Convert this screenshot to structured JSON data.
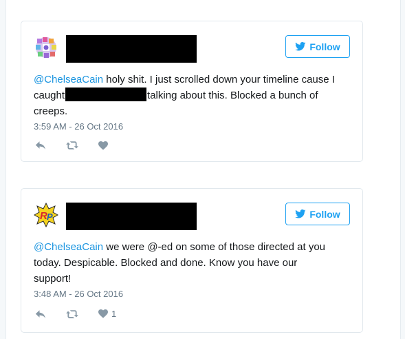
{
  "tweets": [
    {
      "follow_label": "Follow",
      "mention": "@ChelseaCain",
      "text_part1": " holy shit. I just scrolled down your timeline cause I caught",
      "text_part2": "talking about this. Blocked a bunch of creeps.",
      "timestamp": "3:59 AM - 26 Oct 2016",
      "like_count": ""
    },
    {
      "follow_label": "Follow",
      "mention": "@ChelseaCain",
      "text_part1": " we were @-ed on some of those directed at you today. Despicable. Blocked and done. Know you have our support!",
      "text_part2": "",
      "timestamp": "3:48 AM - 26 Oct 2016",
      "like_count": "1"
    }
  ],
  "colors": {
    "accent": "#1da1f2",
    "mention": "#1b95e0",
    "meta": "#657786",
    "icon": "#8899a6",
    "border": "#e1e8ed"
  }
}
